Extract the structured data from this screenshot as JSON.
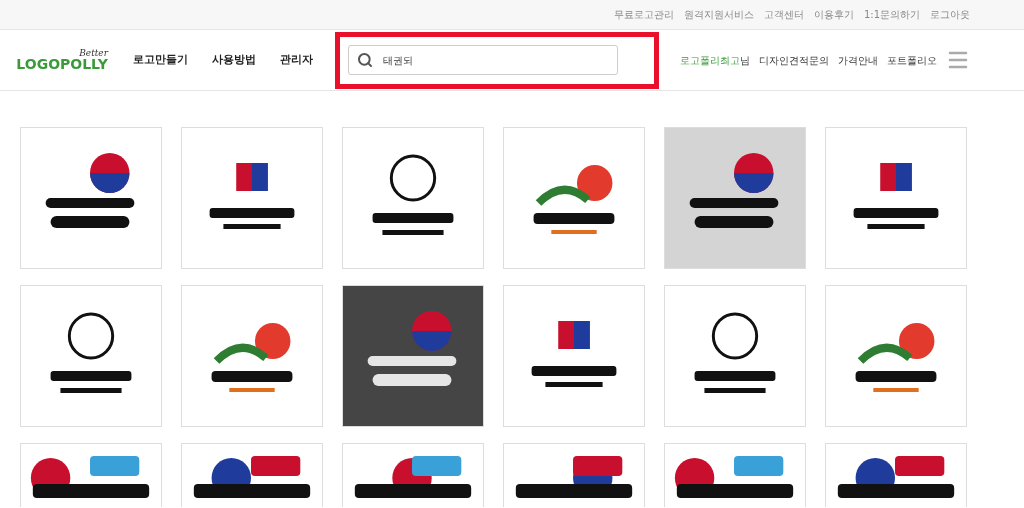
{
  "top_links": [
    "무료로고관리",
    "원격지원서비스",
    "고객센터",
    "이용후기",
    "1:1문의하기",
    "로그아웃"
  ],
  "brand": {
    "tagline": "Better",
    "name": "LOGOPOLLY"
  },
  "nav": [
    "로고만들기",
    "사용방법",
    "관리자"
  ],
  "search": {
    "value": "태권되"
  },
  "user": {
    "name": "로고폴리최고",
    "suffix": "님"
  },
  "right_links": [
    "디자인견적문의",
    "가격안내",
    "포트폴리오"
  ]
}
